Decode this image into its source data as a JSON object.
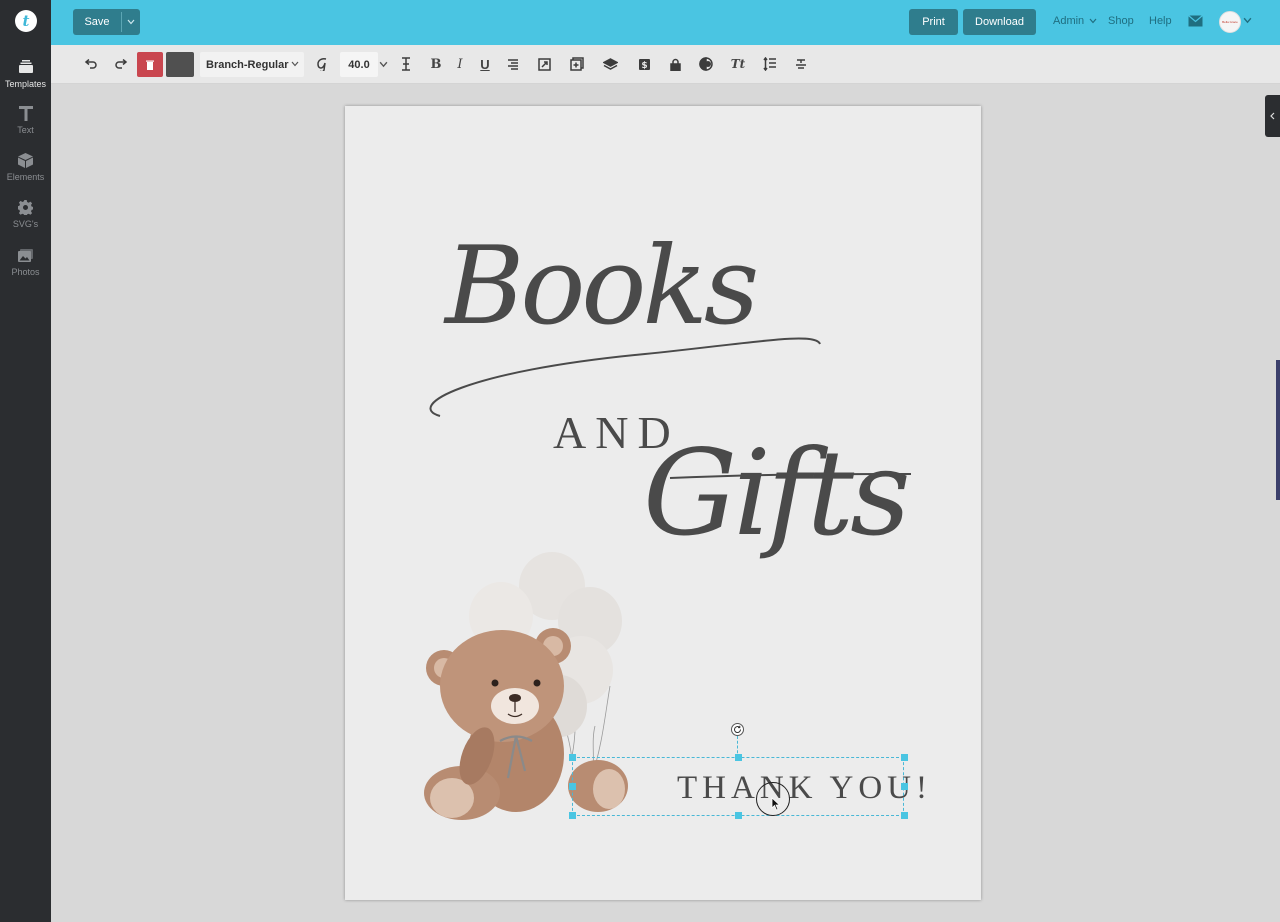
{
  "app": {
    "logo_letter": "t"
  },
  "sidebar": {
    "items": [
      {
        "label": "Templates",
        "icon": "templates-icon",
        "active": true
      },
      {
        "label": "Text",
        "icon": "text-icon",
        "active": false
      },
      {
        "label": "Elements",
        "icon": "elements-icon",
        "active": false
      },
      {
        "label": "SVG's",
        "icon": "gear-icon",
        "active": false
      },
      {
        "label": "Photos",
        "icon": "photos-icon",
        "active": false
      }
    ]
  },
  "topbar": {
    "save_label": "Save",
    "print_label": "Print",
    "download_label": "Download",
    "nav": {
      "admin": "Admin",
      "shop": "Shop",
      "help": "Help"
    },
    "avatar_text": "Bella Grace",
    "accent_color": "#4ac5e2",
    "button_color": "#2f7d8d"
  },
  "toolbar": {
    "font_name": "Branch-Regular",
    "font_size": "40.0",
    "text_color": "#505050",
    "delete_color": "#c9464f",
    "tools": [
      "undo-icon",
      "redo-icon",
      "trash-icon",
      "font-style-icon",
      "letter-spacing-icon",
      "bold-icon",
      "italic-icon",
      "underline-icon",
      "align-icon",
      "resize-icon",
      "duplicate-icon",
      "layers-icon",
      "dollar-icon",
      "lock-icon",
      "opacity-icon",
      "text-transform-icon",
      "line-height-icon",
      "text-path-icon"
    ],
    "bold_glyph": "B",
    "italic_glyph": "I",
    "underline_glyph": "U",
    "transform_glyph": "Tt"
  },
  "canvas": {
    "title_line1": "Books",
    "title_line2": "AND",
    "title_line3": "Gifts",
    "footer_text": "THANK YOU!",
    "illustration": "teddy-bear-with-balloons"
  }
}
